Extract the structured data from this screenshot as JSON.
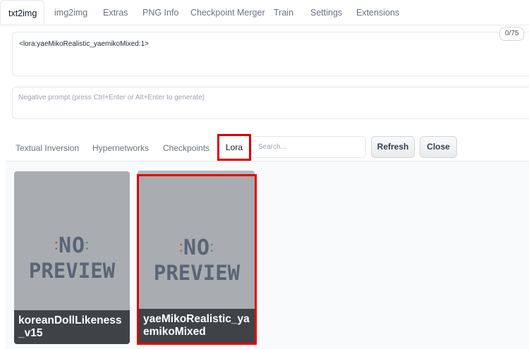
{
  "tabs": [
    "txt2img",
    "img2img",
    "Extras",
    "PNG Info",
    "Checkpoint Merger",
    "Train",
    "Settings",
    "Extensions"
  ],
  "prompt": {
    "value": "<lora:yaeMikoRealistic_yaemikoMixed:1>",
    "token_counter": "0/75"
  },
  "negative_prompt": {
    "placeholder": "Negative prompt (press Ctrl+Enter or Alt+Enter to generate)"
  },
  "extra_networks": {
    "tabs": [
      "Textual Inversion",
      "Hypernetworks",
      "Checkpoints",
      "Lora"
    ],
    "active_tab": "Lora",
    "search_placeholder": "Search...",
    "refresh_label": "Refresh",
    "close_label": "Close"
  },
  "cards": [
    {
      "name": "koreanDollLikeness_v15",
      "preview_line1": "NO",
      "preview_line2": "PREVIEW",
      "highlighted": false
    },
    {
      "name": "yaeMikoRealistic_yaemikoMixed",
      "preview_line1": "NO",
      "preview_line2": "PREVIEW",
      "highlighted": true
    }
  ],
  "colors": {
    "highlight": "#e00000",
    "card_bg": "#a9acb0",
    "label_bg": "#3f4347"
  }
}
